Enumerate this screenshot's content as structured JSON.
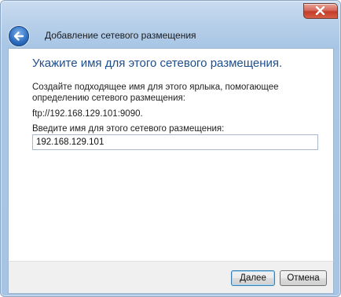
{
  "window": {
    "title": "Добавление сетевого размещения"
  },
  "content": {
    "heading": "Укажите имя для этого сетевого размещения.",
    "description": "Создайте подходящее имя для этого ярлыка, помогающее определению сетевого размещения:",
    "address": "ftp://192.168.129.101:9090.",
    "name_label": "Введите имя для этого сетевого размещения:",
    "name_value": "192.168.129.101"
  },
  "buttons": {
    "next_label": "Далее",
    "cancel_label": "Отмена"
  },
  "icons": {
    "back": "back-arrow-icon",
    "close": "close-icon"
  }
}
